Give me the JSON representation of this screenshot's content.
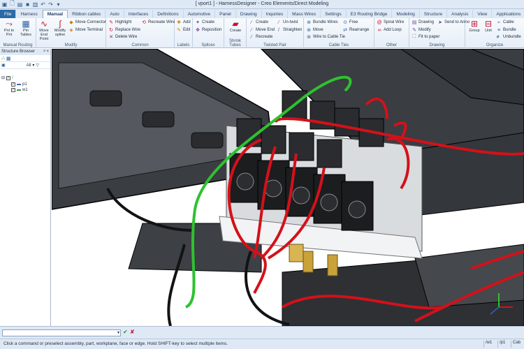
{
  "window": {
    "title": "[ vport1 ] - HarnessDesigner - Creo Elements/Direct Modeling"
  },
  "tabs": [
    "File",
    "Harness",
    "Manual",
    "Ribbon cables",
    "Auto",
    "Interfaces",
    "Definitions",
    "Automotive",
    "Panel",
    "Drawing",
    "Inquiries",
    "Mass Wires",
    "Settings",
    "E3 Routing Bridge",
    "Modeling",
    "Structure",
    "Analysis",
    "View",
    "Applications"
  ],
  "active_tab": "Manual",
  "ribbon": {
    "manual_routing": {
      "label": "Manual Routing",
      "pnt_to_pnt": "Pnt to Pnt",
      "pin_tables": "Pin Tables"
    },
    "modify": {
      "label": "Modify",
      "move_end_point": "Move End Point",
      "modify_spline": "Modify spline",
      "move_connector": "Move Connector",
      "move_terminal": "Move Terminal"
    },
    "common": {
      "label": "Common",
      "highlight": "Highlight",
      "replace_wire": "Replace Wire",
      "delete_wire": "Delete Wire",
      "recreate_wire": "Recreate Wire"
    },
    "labels": {
      "label": "Labels",
      "add": "Add",
      "edit": "Edit"
    },
    "splices": {
      "label": "Splices",
      "create": "Create",
      "reposition": "Reposition"
    },
    "shrink_tubes": {
      "label": "Shrink Tubes",
      "create": "Create"
    },
    "twisted_pair": {
      "label": "Twisted Pair",
      "create": "Create",
      "move_end": "Move End",
      "recreate": "Recreate",
      "untwist": "Un-twist",
      "straighten": "Straighten"
    },
    "cable_ties": {
      "label": "Cable Ties",
      "bundle_wires": "Bundle Wires",
      "move": "Move",
      "wire_to_cable_tie": "Wire to Cable Tie",
      "free": "Free",
      "rearrange": "Rearrange"
    },
    "other": {
      "label": "Other",
      "spiral_wire": "Spiral Wire",
      "add_loop": "Add Loop"
    },
    "drawing": {
      "label": "Drawing",
      "drawing": "Drawing",
      "modify": "Modify",
      "fit_to_paper": "Fit to paper",
      "send_to_anno": "Send to Anno"
    },
    "organize": {
      "label": "Organize",
      "group": "Group",
      "unit": "Unit",
      "cable": "Cable",
      "bundle": "Bundle",
      "unbundle": "Unbundle"
    }
  },
  "browser": {
    "title": "Structure Browser",
    "filter_value": "All",
    "items": [
      {
        "label": "/",
        "checked": true
      },
      {
        "label": "p1",
        "checked": true
      },
      {
        "label": "w1",
        "checked": true
      }
    ]
  },
  "commandline": {
    "value": ""
  },
  "status": {
    "text": "Click a command or preselect assembly, part, workplane, face or edge. Hold SHIFT-key to select multiple items.",
    "cells": [
      "/w1",
      "/p1",
      "Cab"
    ]
  }
}
